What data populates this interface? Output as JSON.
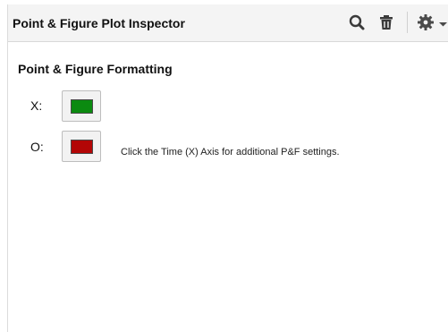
{
  "header": {
    "title": "Point & Figure Plot Inspector",
    "icons": [
      "search-icon",
      "trash-icon",
      "gear-icon",
      "chevron-down-icon"
    ]
  },
  "section": {
    "title": "Point & Figure Formatting"
  },
  "rows": [
    {
      "label": "X:",
      "color": "#0b8a10"
    },
    {
      "label": "O:",
      "color": "#b30606"
    }
  ],
  "note": "Click the Time (X) Axis for additional P&F settings."
}
